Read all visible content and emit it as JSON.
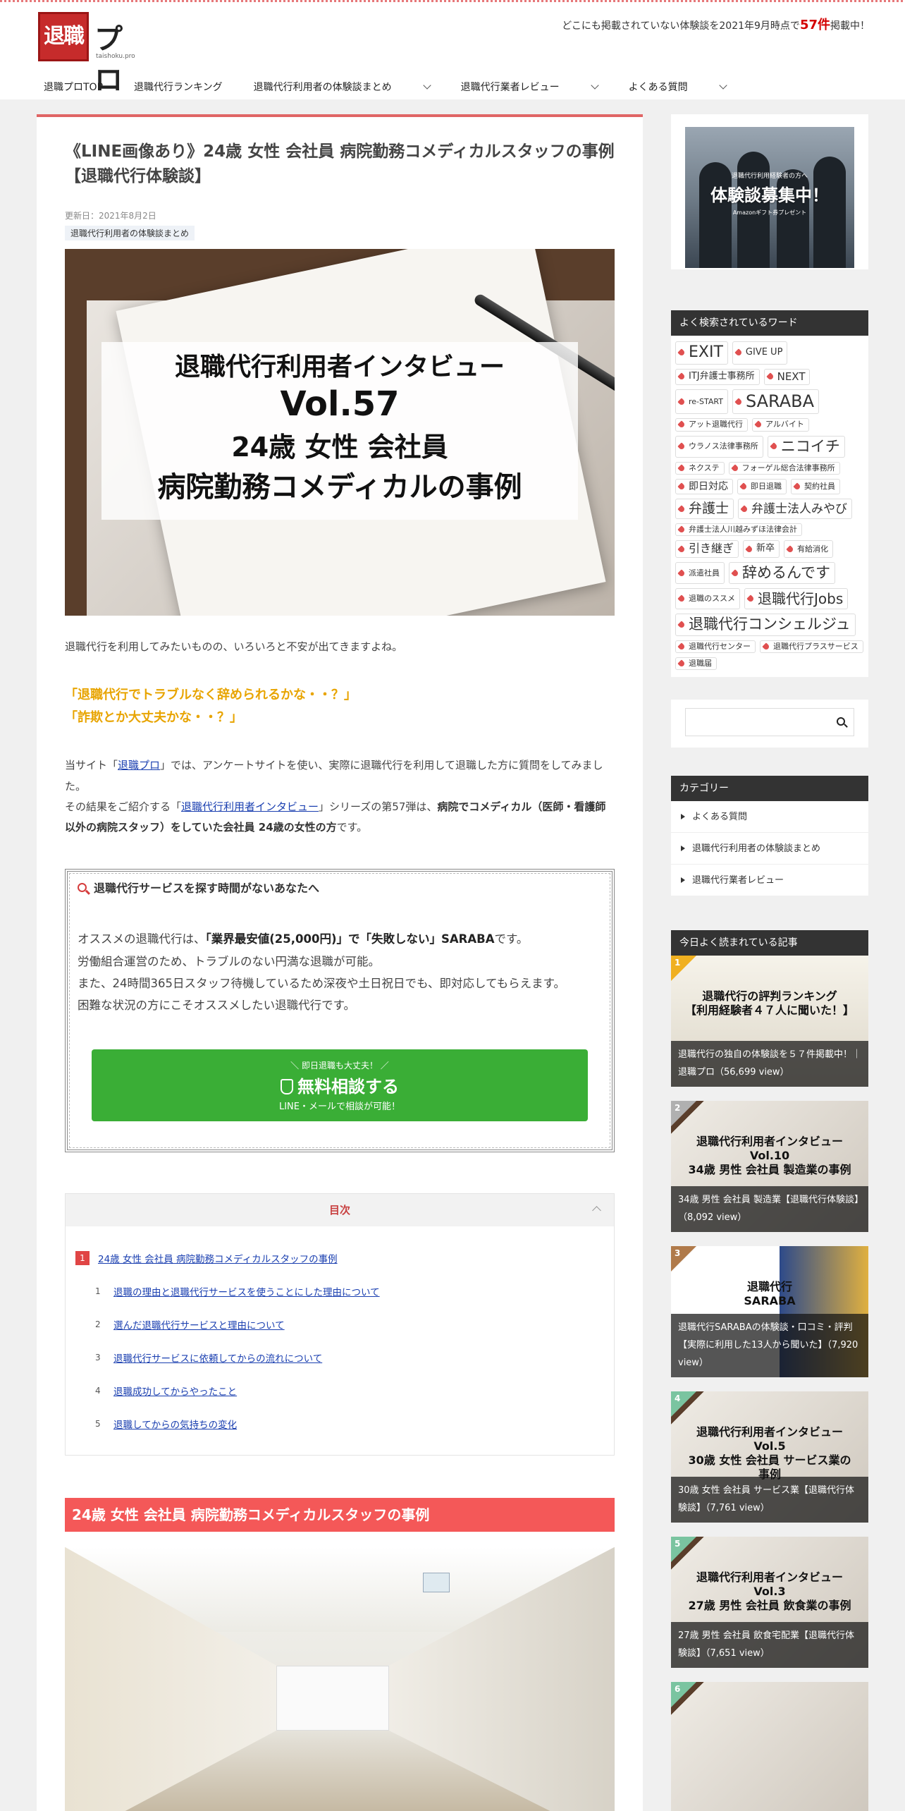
{
  "header": {
    "logo_mark": "退職",
    "logo_text": "プロ",
    "logo_sub": "taishoku.pro",
    "tagline_before": "どこにも掲載されていない体験談を2021年9月時点で",
    "tagline_count": "57件",
    "tagline_after": "掲載中！"
  },
  "nav": [
    {
      "label": "退職プロTOP",
      "has_sub": false
    },
    {
      "label": "退職代行ランキング",
      "has_sub": false
    },
    {
      "label": "退職代行利用者の体験談まとめ",
      "has_sub": true
    },
    {
      "label": "退職代行業者レビュー",
      "has_sub": true
    },
    {
      "label": "よくある質問",
      "has_sub": true
    }
  ],
  "article": {
    "title": "《LINE画像あり》24歳 女性 会社員 病院勤務コメディカルスタッフの事例【退職代行体験談】",
    "updated": "更新日：2021年8月2日",
    "category": "退職代行利用者の体験談まとめ",
    "hero": {
      "line1": "退職代行利用者インタビュー",
      "line2": "Vol.57",
      "line3": "24歳 女性 会社員",
      "line4": "病院勤務コメディカルの事例"
    },
    "intro": "退職代行を利用してみたいものの、いろいろと不安が出てきますよね。",
    "quote1": "「退職代行でトラブルなく辞められるかな・・？」",
    "quote2": "「詐欺とか大丈夫かな・・？」",
    "p1_a": "当サイト「",
    "p1_link": "退職プロ",
    "p1_b": "」では、アンケートサイトを使い、実際に退職代行を利用して退職した方に質問をしてみました。",
    "p2_a": "その結果をご紹介する「",
    "p2_link": "退職代行利用者インタビュー",
    "p2_b": "」シリーズの第57弾は、",
    "p2_bold": "病院でコメディカル（医師・看護師以外の病院スタッフ）をしていた会社員 24歳の女性の方",
    "p2_c": "です。",
    "promo": {
      "heading": "退職代行サービスを探す時間がないあなたへ",
      "l1_a": "オススメの退職代行は、",
      "l1_b": "「業界最安値(25,000円)」で「失敗しない」SARABA",
      "l1_c": "です。",
      "l2": "労働組合運営のため、トラブルのない円満な退職が可能。",
      "l3": "また、24時間365日スタッフ待機しているため深夜や土日祝日でも、即対応してもらえます。",
      "l4": "困難な状況の方にこそオススメしたい退職代行です。",
      "cta_small": "＼ 即日退職も大丈夫！ ／",
      "cta_main": "無料相談する",
      "cta_sub": "LINE・メールで相談が可能！"
    },
    "toc": {
      "title": "目次",
      "items": [
        {
          "num": "1",
          "label": "24歳 女性 会社員 病院勤務コメディカルスタッフの事例",
          "level": 1
        },
        {
          "num": "1",
          "label": "退職の理由と退職代行サービスを使うことにした理由について",
          "level": 2
        },
        {
          "num": "2",
          "label": "選んだ退職代行サービスと理由について",
          "level": 2
        },
        {
          "num": "3",
          "label": "退職代行サービスに依頼してからの流れについて",
          "level": 2
        },
        {
          "num": "4",
          "label": "退職成功してからやったこと",
          "level": 2
        },
        {
          "num": "5",
          "label": "退職してからの気持ちの変化",
          "level": 2
        }
      ]
    },
    "section_heading": "24歳 女性 会社員 病院勤務コメディカルスタッフの事例"
  },
  "sidebar": {
    "ad": {
      "t1": "退職代行利用経験者の方へ",
      "t2": "体験談募集中！",
      "t3": "Amazonギフト券プレゼント"
    },
    "tags_title": "よく検索されているワード",
    "tags": [
      {
        "label": "EXIT",
        "size": 22
      },
      {
        "label": "GIVE UP",
        "size": 13
      },
      {
        "label": "ITJ弁護士事務所",
        "size": 13
      },
      {
        "label": "NEXT",
        "size": 15
      },
      {
        "label": "re-START",
        "size": 11
      },
      {
        "label": "SARABA",
        "size": 24
      },
      {
        "label": "アット退職代行",
        "size": 11
      },
      {
        "label": "アルバイト",
        "size": 11
      },
      {
        "label": "ウラノス法律事務所",
        "size": 11
      },
      {
        "label": "ニコイチ",
        "size": 21
      },
      {
        "label": "ネクステ",
        "size": 11
      },
      {
        "label": "フォーゲル総合法律事務所",
        "size": 11
      },
      {
        "label": "即日対応",
        "size": 14
      },
      {
        "label": "即日退職",
        "size": 11
      },
      {
        "label": "契約社員",
        "size": 11
      },
      {
        "label": "弁護士",
        "size": 19
      },
      {
        "label": "弁護士法人みやび",
        "size": 17
      },
      {
        "label": "弁護士法人川越みずほ法律会計",
        "size": 11
      },
      {
        "label": "引き継ぎ",
        "size": 16
      },
      {
        "label": "新卒",
        "size": 13
      },
      {
        "label": "有給消化",
        "size": 11
      },
      {
        "label": "派遣社員",
        "size": 11
      },
      {
        "label": "辞めるんです",
        "size": 21
      },
      {
        "label": "退職のススメ",
        "size": 11
      },
      {
        "label": "退職代行Jobs",
        "size": 20
      },
      {
        "label": "退職代行コンシェルジュ",
        "size": 21
      },
      {
        "label": "退職代行センター",
        "size": 11
      },
      {
        "label": "退職代行プラスサービス",
        "size": 11
      },
      {
        "label": "退職届",
        "size": 11
      }
    ],
    "categories_title": "カテゴリー",
    "categories": [
      "よくある質問",
      "退職代行利用者の体験談まとめ",
      "退職代行業者レビュー"
    ],
    "popular_title": "今日よく読まれている記事",
    "popular": [
      {
        "rank": "1",
        "rank_color": "#f0b020",
        "overlay": "退職代行の評判ランキング\n【利用経験者４７人に聞いた！】",
        "caption": "退職代行の独自の体験談を５７件掲載中！｜退職プロ（56,699 view）",
        "bg": "linear-gradient(180deg,#f6f3ea,#dcd6c8)"
      },
      {
        "rank": "2",
        "rank_color": "#b0b0b0",
        "overlay": "退職代行利用者インタビュー\nVol.10\n34歳 男性 会社員 製造業の事例",
        "caption": "34歳 男性 会社員 製造業【退職代行体験談】（8,092 view）",
        "bg": "linear-gradient(135deg,#5a3e2b 0 10%,#ece8e1 10%,#cfc8be 100%)"
      },
      {
        "rank": "3",
        "rank_color": "#b07a4a",
        "overlay": "退職代行\nSARABA",
        "caption": "退職代行SARABAの体験談・口コミ・評判【実際に利用した13人から聞いた】（7,920 view）",
        "bg": "linear-gradient(90deg,#ffffff 0 55%,#2d4a8a 55%,#e0b040 100%)"
      },
      {
        "rank": "4",
        "rank_color": "#7ac4a0",
        "overlay": "退職代行利用者インタビュー\nVol.5\n30歳 女性 会社員 サービス業の事例",
        "caption": "30歳 女性 会社員 サービス業【退職代行体験談】（7,761 view）",
        "bg": "linear-gradient(135deg,#5a3e2b 0 10%,#ece8e1 10%,#cfc8be 100%)"
      },
      {
        "rank": "5",
        "rank_color": "#7ac4a0",
        "overlay": "退職代行利用者インタビュー\nVol.3\n27歳 男性 会社員 飲食業の事例",
        "caption": "27歳 男性 会社員 飲食宅配業【退職代行体験談】（7,651 view）",
        "bg": "linear-gradient(135deg,#5a3e2b 0 10%,#ece8e1 10%,#cfc8be 100%)"
      },
      {
        "rank": "6",
        "rank_color": "#7ac4a0",
        "overlay": "",
        "caption": "",
        "bg": "linear-gradient(135deg,#5a3e2b 0 10%,#ece8e1 10%,#cfc8be 100%)"
      }
    ]
  }
}
